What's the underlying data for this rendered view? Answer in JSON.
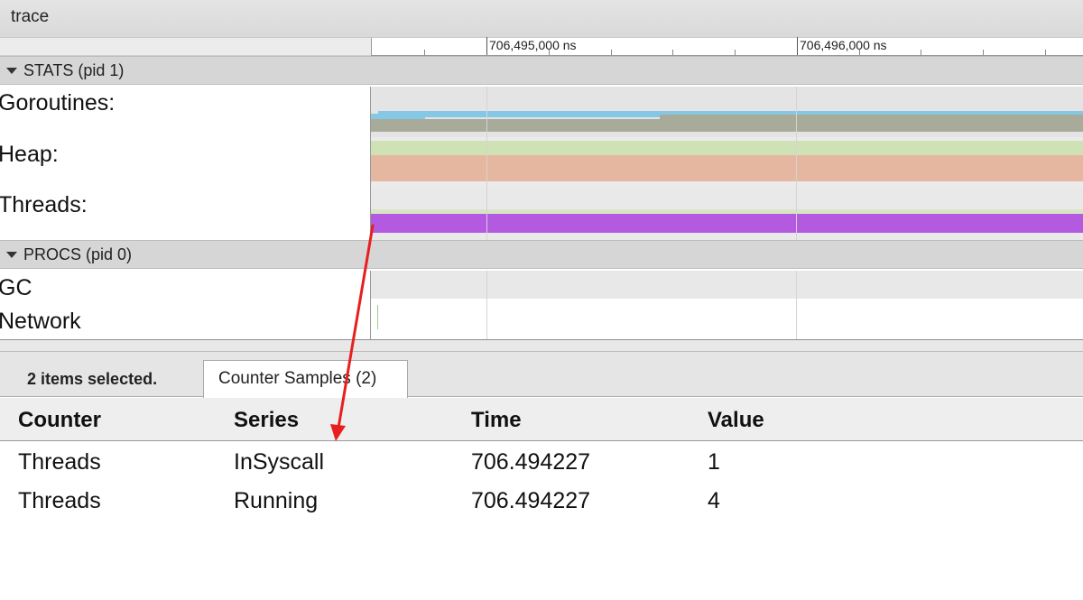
{
  "window": {
    "title": "trace"
  },
  "ruler": {
    "labels": [
      "706,495,000 ns",
      "706,496,000 ns"
    ]
  },
  "sections": {
    "stats": {
      "label": "STATS (pid 1)",
      "tracks": [
        "Goroutines:",
        "Heap:",
        "Threads:"
      ]
    },
    "procs": {
      "label": "PROCS (pid 0)",
      "tracks": [
        "GC",
        "Network"
      ]
    }
  },
  "colors": {
    "goroutines_top": "#84c8e6",
    "goroutines_bottom": "#a8ab9a",
    "heap_top": "#cfe2b5",
    "heap_bottom": "#e5b6a0",
    "threads_running": "#b45ae0",
    "threads_insyscall": "#d9e4c6",
    "annotation_arrow": "#e81f1f"
  },
  "details": {
    "selection_count": "2 items selected.",
    "tab_label": "Counter Samples (2)",
    "columns": [
      "Counter",
      "Series",
      "Time",
      "Value"
    ],
    "rows": [
      [
        "Threads",
        "InSyscall",
        "706.494227",
        "1"
      ],
      [
        "Threads",
        "Running",
        "706.494227",
        "4"
      ]
    ]
  }
}
